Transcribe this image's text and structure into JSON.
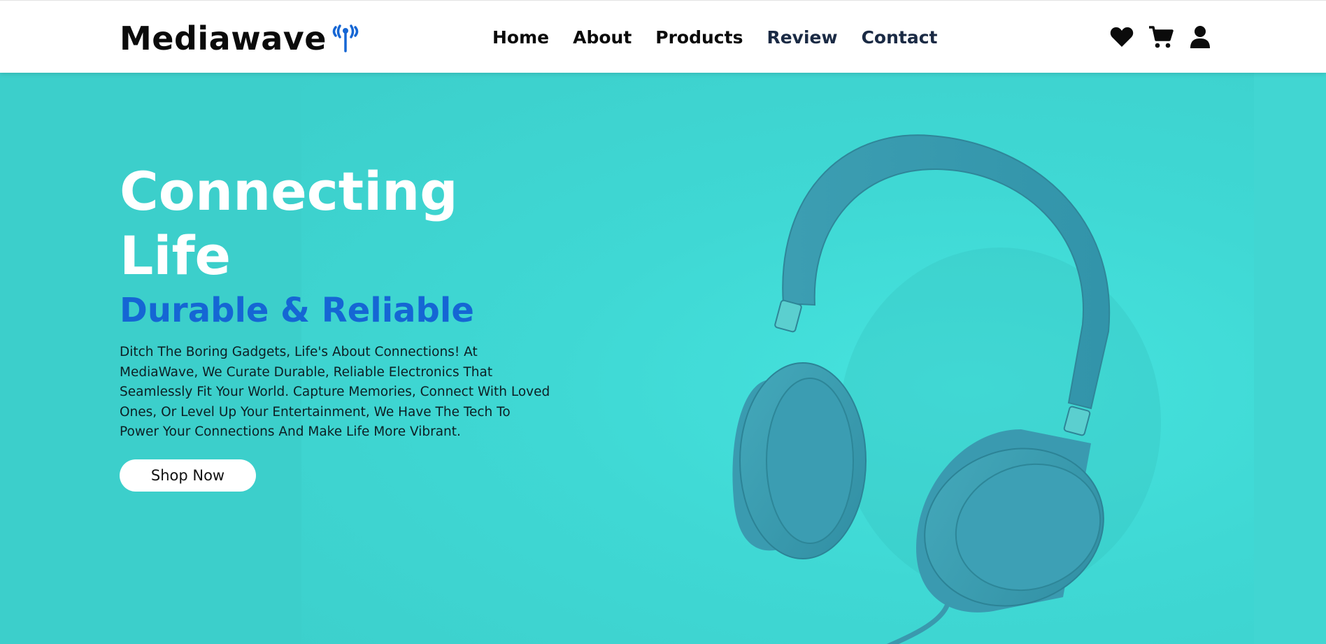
{
  "brand": {
    "name": "Mediawave",
    "accent_color": "#1566d4"
  },
  "nav": {
    "items": [
      {
        "label": "Home"
      },
      {
        "label": "About"
      },
      {
        "label": "Products"
      },
      {
        "label": "Review"
      },
      {
        "label": "Contact"
      }
    ]
  },
  "header_icons": [
    "heart-icon",
    "cart-icon",
    "user-icon"
  ],
  "hero": {
    "title": "Connecting Life",
    "subtitle": "Durable & Reliable",
    "description": "Ditch The Boring Gadgets, Life's About Connections! At MediaWave, We Curate Durable, Reliable Electronics That Seamlessly Fit Your World. Capture Memories, Connect With Loved Ones, Or Level Up Your Entertainment, We Have The Tech To Power Your Connections And Make Life More Vibrant.",
    "cta_label": "Shop Now",
    "background_color": "#3fd3cf",
    "title_color": "#ffffff",
    "subtitle_color": "#1566d4"
  }
}
